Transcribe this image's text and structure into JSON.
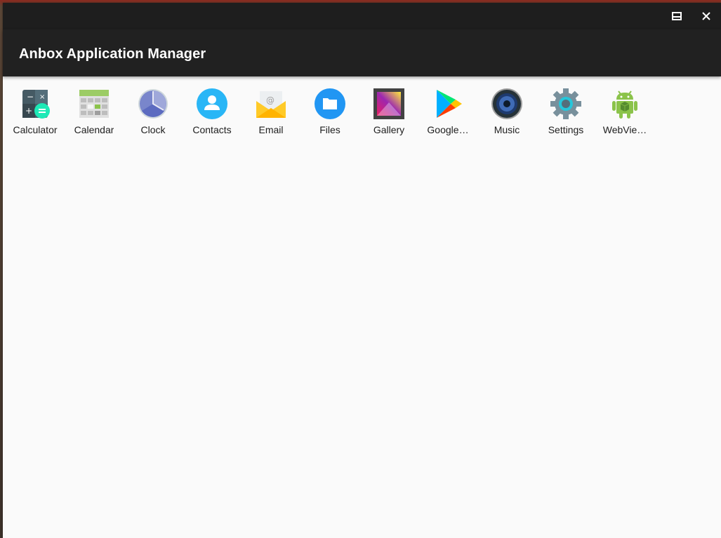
{
  "window": {
    "title": "Anbox Application Manager",
    "controls": {
      "maximize_icon": "maximize-icon",
      "close_icon": "close-icon"
    }
  },
  "colors": {
    "titlebar": "#1e1e1e",
    "appbar": "#212121",
    "content_background": "#fafafa"
  },
  "apps": [
    {
      "label": "Calculator",
      "icon": "calculator-icon"
    },
    {
      "label": "Calendar",
      "icon": "calendar-icon"
    },
    {
      "label": "Clock",
      "icon": "clock-icon"
    },
    {
      "label": "Contacts",
      "icon": "contacts-icon"
    },
    {
      "label": "Email",
      "icon": "email-icon"
    },
    {
      "label": "Files",
      "icon": "files-icon"
    },
    {
      "label": "Gallery",
      "icon": "gallery-icon"
    },
    {
      "label": "Google…",
      "icon": "google-play-icon"
    },
    {
      "label": "Music",
      "icon": "music-icon"
    },
    {
      "label": "Settings",
      "icon": "settings-icon"
    },
    {
      "label": "WebVie…",
      "icon": "android-icon"
    }
  ]
}
